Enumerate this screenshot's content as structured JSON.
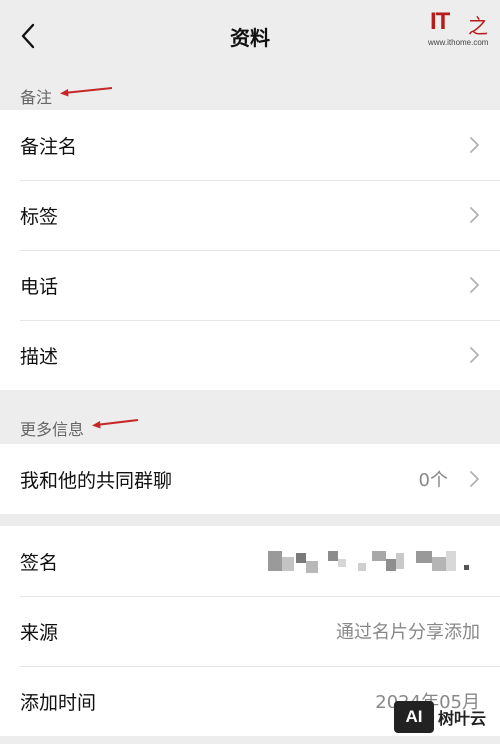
{
  "header": {
    "title": "资料",
    "back_icon": "chevron-left-icon"
  },
  "watermark_top": {
    "logo_text": "IT",
    "logo_char": "之",
    "url": "www.ithome.com"
  },
  "sections": {
    "remark": {
      "label": "备注",
      "items": [
        {
          "label": "备注名"
        },
        {
          "label": "标签"
        },
        {
          "label": "电话"
        },
        {
          "label": "描述"
        }
      ]
    },
    "more_info": {
      "label": "更多信息",
      "items": [
        {
          "label": "我和他的共同群聊",
          "value": "0个"
        }
      ]
    },
    "profile": {
      "items": [
        {
          "label": "签名",
          "value": ""
        },
        {
          "label": "来源",
          "value": "通过名片分享添加"
        },
        {
          "label": "添加时间",
          "value": "2024年05月"
        }
      ]
    }
  },
  "watermark_bottom": {
    "box_text": "AI",
    "brand_text": "树叶云"
  },
  "colors": {
    "background": "#ededed",
    "card": "#ffffff",
    "annotation_arrow": "#c62828",
    "watermark_red": "#b71c1c"
  }
}
